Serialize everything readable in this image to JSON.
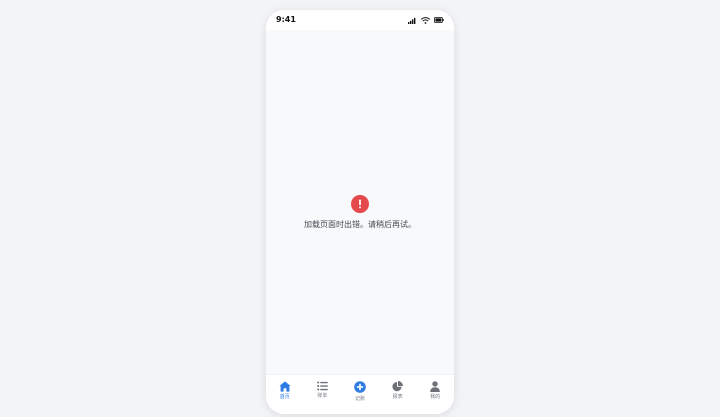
{
  "status_bar": {
    "time": "9:41",
    "icons": [
      "signal-icon",
      "wifi-icon",
      "battery-icon"
    ]
  },
  "error": {
    "icon": "error-exclamation-icon",
    "message": "加载页面时出错。请稍后再试。",
    "color": "#e5484d"
  },
  "tab_bar": {
    "active_color": "#2d7be5",
    "inactive_color": "#777d86",
    "tabs": [
      {
        "label": "首页",
        "icon": "home-icon",
        "active": true
      },
      {
        "label": "账单",
        "icon": "list-icon",
        "active": false
      },
      {
        "label": "记账",
        "icon": "add-circle-icon",
        "active": false
      },
      {
        "label": "报表",
        "icon": "pie-chart-icon",
        "active": false
      },
      {
        "label": "我的",
        "icon": "user-icon",
        "active": false
      }
    ]
  }
}
